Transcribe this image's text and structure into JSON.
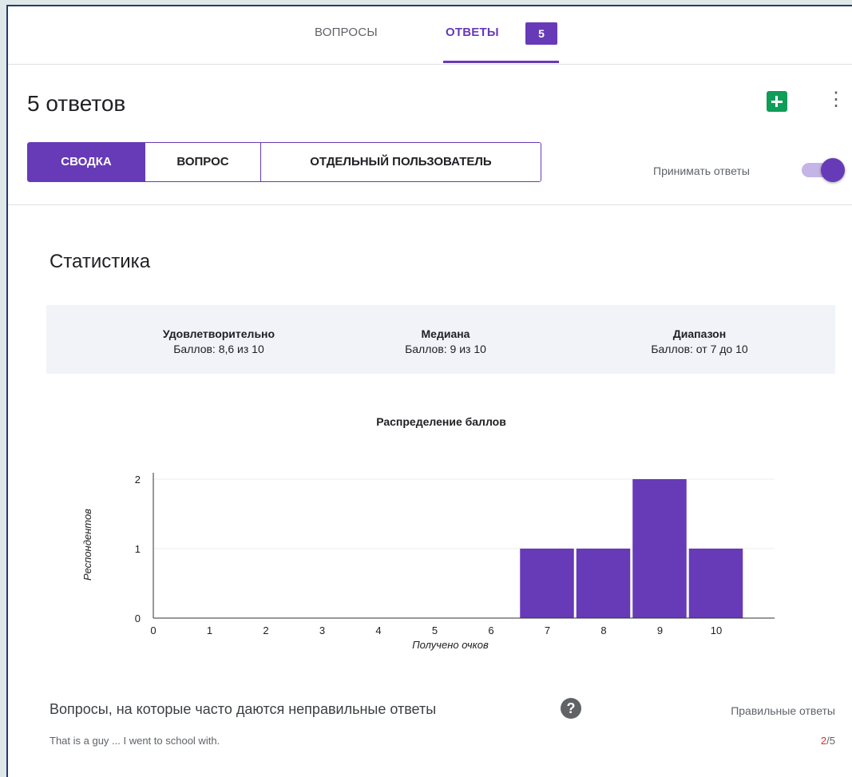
{
  "tabs": {
    "questions": "ВОПРОСЫ",
    "answers": "ОТВЕТЫ",
    "answers_count": "5"
  },
  "header": {
    "title": "5 ответов",
    "sheets_icon": "sheets-icon",
    "more_icon": "more-vert-icon"
  },
  "segments": [
    "СВОДКА",
    "ВОПРОС",
    "ОТДЕЛЬНЫЙ ПОЛЬЗОВАТЕЛЬ"
  ],
  "accept": {
    "label": "Принимать ответы",
    "enabled": true
  },
  "stats": {
    "title": "Статистика",
    "items": [
      {
        "label": "Удовлетворительно",
        "value": "Баллов: 8,6 из 10"
      },
      {
        "label": "Медиана",
        "value": "Баллов: 9 из 10"
      },
      {
        "label": "Диапазон",
        "value": "Баллов: от 7 до 10"
      }
    ]
  },
  "chart_data": {
    "type": "bar",
    "title": "Распределение баллов",
    "xlabel": "Получено очков",
    "ylabel": "Респондентов",
    "categories": [
      "0",
      "1",
      "2",
      "3",
      "4",
      "5",
      "6",
      "7",
      "8",
      "9",
      "10"
    ],
    "values": [
      0,
      0,
      0,
      0,
      0,
      0,
      0,
      1,
      1,
      2,
      1
    ],
    "yticks": [
      "0",
      "1",
      "2"
    ],
    "ylim": [
      0,
      2
    ],
    "color": "#673ab7"
  },
  "wrong": {
    "title": "Вопросы, на которые часто даются неправильные ответы",
    "correct_label": "Правильные ответы",
    "items": [
      {
        "text": "That is a guy ... I went to school with.",
        "correct": "2",
        "total": "/5"
      }
    ]
  },
  "colors": {
    "accent": "#673ab7",
    "error": "#d93025"
  }
}
